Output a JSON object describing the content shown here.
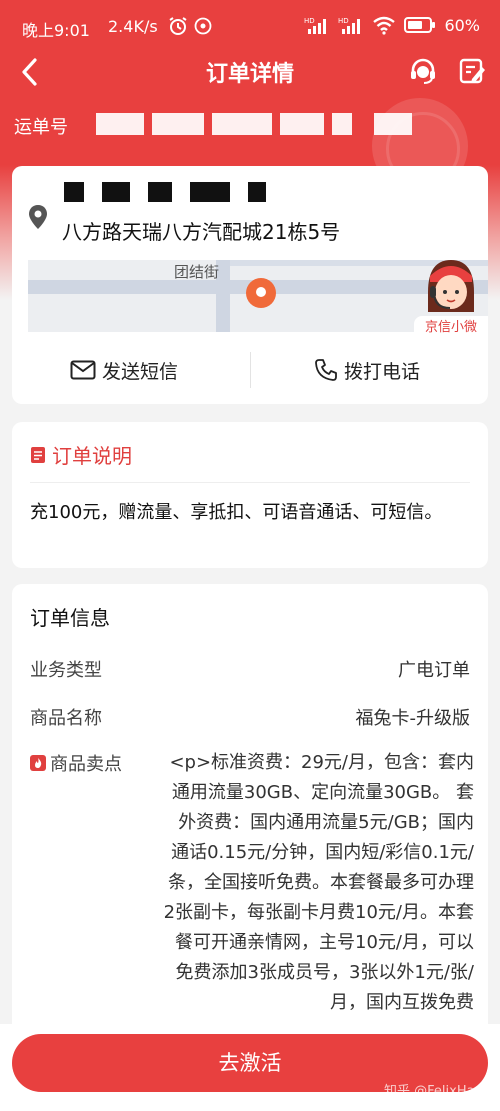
{
  "status_bar": {
    "time": "晚上9:01",
    "speed": "2.4K/s",
    "battery": "60%"
  },
  "nav": {
    "title": "订单详情"
  },
  "waybill": {
    "label": "运单号"
  },
  "address": {
    "text": "八方路天瑞八方汽配城21栋5号"
  },
  "map": {
    "street_label": "团结街",
    "assistant_label": "京信小微"
  },
  "actions": {
    "sms": "发送短信",
    "call": "拨打电话"
  },
  "order_desc": {
    "title": "订单说明",
    "text": "充100元，赠流量、享抵扣、可语音通话、可短信。"
  },
  "order_info": {
    "title": "订单信息",
    "rows": [
      {
        "key": "业务类型",
        "value": "广电订单"
      },
      {
        "key": "商品名称",
        "value": "福兔卡-升级版"
      }
    ],
    "selling_points_key": "商品卖点",
    "selling_points_value": "<p>标准资费：29元/月，包含：套内通用流量30GB、定向流量30GB。 套外资费：国内通用流量5元/GB；国内通话0.15元/分钟，国内短/彩信0.1元/条，全国接听免费。本套餐最多可办理2张副卡，每张副卡月费10元/月。本套餐可开通亲情网，主号10元/月，可以免费添加3张成员号，3张以外1元/张/月，国内互拨免费"
  },
  "bottom": {
    "activate": "去激活",
    "watermark": "知乎 @FelixHan"
  },
  "colors": {
    "brand_red": "#e8403f",
    "map_pin": "#f06a3a"
  }
}
